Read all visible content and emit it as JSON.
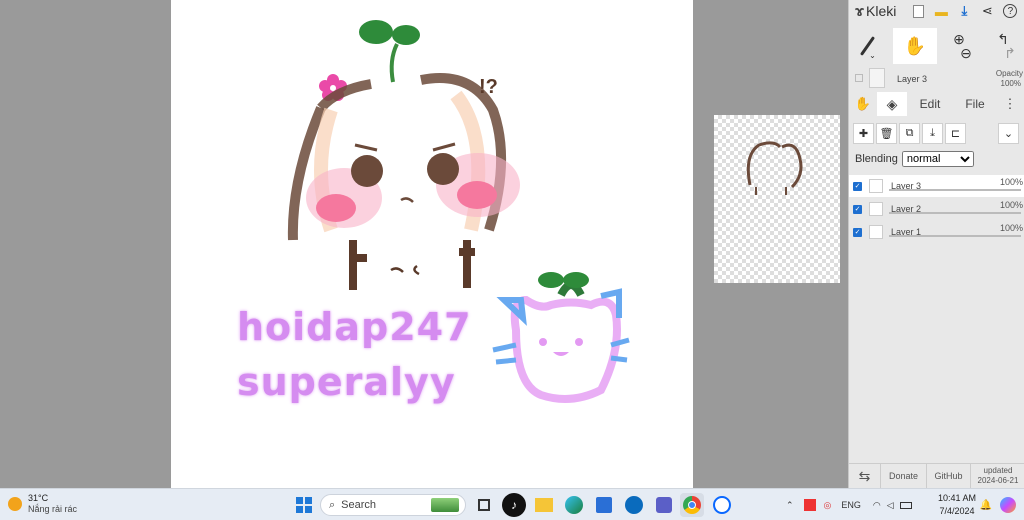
{
  "app": {
    "name": "Kleki",
    "layer_label": "Layer 3",
    "opacity_label": "Opacity",
    "opacity_value": "100%"
  },
  "tabs": [
    "Edit",
    "File"
  ],
  "blending": {
    "label": "Blending",
    "value": "normal"
  },
  "layers": [
    {
      "name": "Layer 3",
      "opacity": "100%",
      "visible": true,
      "selected": true
    },
    {
      "name": "Layer 2",
      "opacity": "100%",
      "visible": true,
      "selected": false
    },
    {
      "name": "Layer 1",
      "opacity": "100%",
      "visible": true,
      "selected": false
    }
  ],
  "footer": {
    "donate": "Donate",
    "github": "GitHub",
    "updated_label": "updated",
    "updated_date": "2024-06-21"
  },
  "canvas_text": {
    "line1": "hoidap247",
    "line2": "superalyy"
  },
  "canvas_marks": {
    "question": "!?"
  },
  "taskbar": {
    "weather_temp": "31°C",
    "weather_desc": "Nắng rải rác",
    "search_placeholder": "Search",
    "language": "ENG",
    "time": "10:41 AM",
    "date": "7/4/2024"
  },
  "colors": {
    "accent": "#1e6fd0",
    "art_text": "#d58cf0",
    "leaf": "#2e8b3a",
    "blush": "#f58ab0"
  }
}
